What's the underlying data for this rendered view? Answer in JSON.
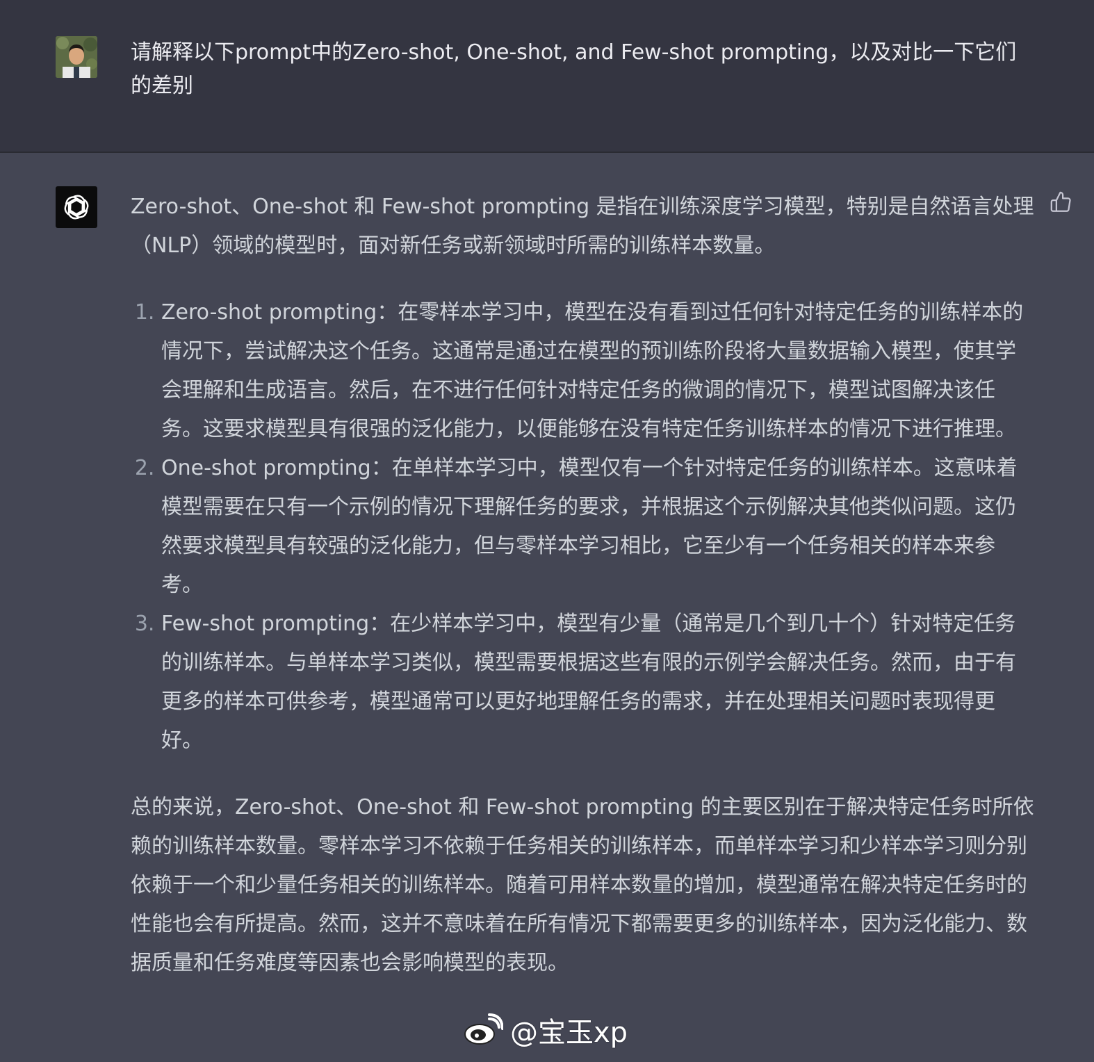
{
  "user_message": {
    "text": "请解释以下prompt中的Zero-shot, One-shot, and Few-shot prompting，以及对比一下它们的差别"
  },
  "assistant_message": {
    "intro": "Zero-shot、One-shot 和 Few-shot prompting 是指在训练深度学习模型，特别是自然语言处理（NLP）领域的模型时，面对新任务或新领域时所需的训练样本数量。",
    "items": [
      "Zero-shot prompting：在零样本学习中，模型在没有看到过任何针对特定任务的训练样本的情况下，尝试解决这个任务。这通常是通过在模型的预训练阶段将大量数据输入模型，使其学会理解和生成语言。然后，在不进行任何针对特定任务的微调的情况下，模型试图解决该任务。这要求模型具有很强的泛化能力，以便能够在没有特定任务训练样本的情况下进行推理。",
      "One-shot prompting：在单样本学习中，模型仅有一个针对特定任务的训练样本。这意味着模型需要在只有一个示例的情况下理解任务的要求，并根据这个示例解决其他类似问题。这仍然要求模型具有较强的泛化能力，但与零样本学习相比，它至少有一个任务相关的样本来参考。",
      "Few-shot prompting：在少样本学习中，模型有少量（通常是几个到几十个）针对特定任务的训练样本。与单样本学习类似，模型需要根据这些有限的示例学会解决任务。然而，由于有更多的样本可供参考，模型通常可以更好地理解任务的需求，并在处理相关问题时表现得更好。"
    ],
    "summary": "总的来说，Zero-shot、One-shot 和 Few-shot prompting 的主要区别在于解决特定任务时所依赖的训练样本数量。零样本学习不依赖于任务相关的训练样本，而单样本学习和少样本学习则分别依赖于一个和少量任务相关的训练样本。随着可用样本数量的增加，模型通常在解决特定任务时的性能也会有所提高。然而，这并不意味着在所有情况下都需要更多的训练样本，因为泛化能力、数据质量和任务难度等因素也会影响模型的表现。"
  },
  "watermark": {
    "text": "@宝玉xp"
  },
  "icons": {
    "user_avatar": "user-avatar-photo",
    "assistant_avatar": "openai-logo-icon",
    "feedback": "thumbs-up-icon",
    "watermark_logo": "weibo-icon"
  },
  "colors": {
    "user_bg": "#343541",
    "assistant_bg": "#444654",
    "text": "#d1d5db"
  }
}
